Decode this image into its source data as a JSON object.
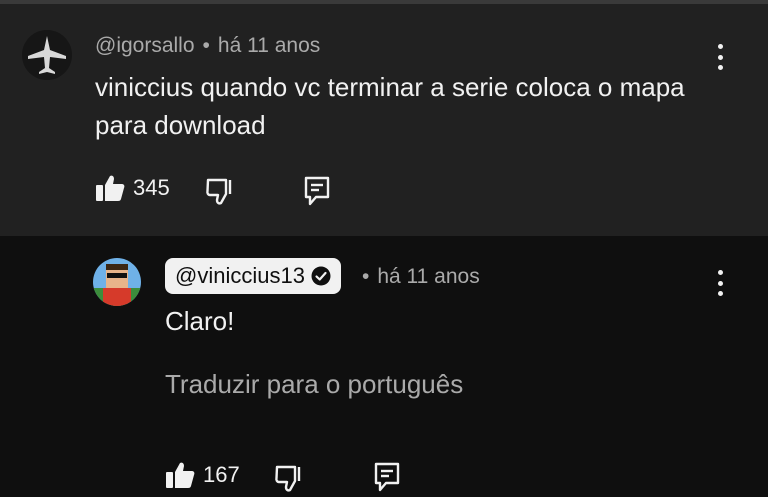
{
  "comment": {
    "handle": "@igorsallo",
    "separator": "•",
    "time": "há 11 anos",
    "text": "viniccius quando vc terminar a serie coloca o mapa para download",
    "likes": "345",
    "icons": [
      "avatar-igorsallo",
      "thumbs-up-icon",
      "thumbs-down-icon",
      "reply-icon",
      "more-vert-icon"
    ]
  },
  "reply": {
    "handle": "@viniccius13",
    "separator": "•",
    "time": "há 11 anos",
    "text": "Claro!",
    "translate": "Traduzir para o português",
    "likes": "167",
    "icons": [
      "avatar-viniccius13",
      "verified-icon",
      "thumbs-up-icon",
      "thumbs-down-icon",
      "reply-icon",
      "more-vert-icon"
    ]
  },
  "colors": {
    "comment_bg": "#212121",
    "reply_bg": "#0f0f0f",
    "primary_text": "#f1f1f1",
    "secondary_text": "#aaaaaa",
    "chip_bg": "#f1f1f1"
  }
}
